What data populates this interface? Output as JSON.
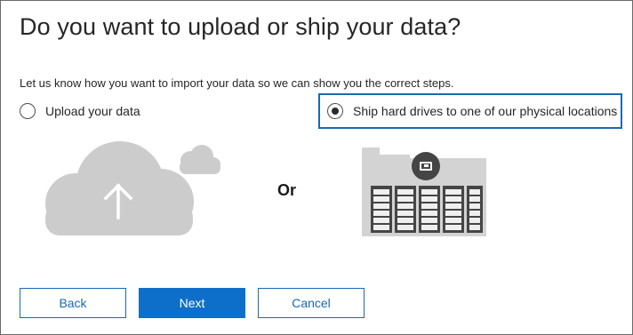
{
  "dialog": {
    "title": "Do you want to upload or ship your data?",
    "subtitle": "Let us know how you want to import your data so we can show you the correct steps."
  },
  "options": [
    {
      "label": "Upload your data",
      "selected": false,
      "icon": "cloud-upload-icon"
    },
    {
      "label": "Ship hard drives to one of our physical locations",
      "selected": true,
      "icon": "server-rack-icon"
    }
  ],
  "separator_text": "Or",
  "buttons": {
    "back": "Back",
    "next": "Next",
    "cancel": "Cancel"
  },
  "colors": {
    "accent": "#0e6fcb",
    "selection_border": "#1a69b4",
    "illustration_gray": "#cccccc",
    "rack_dark": "#454545"
  }
}
